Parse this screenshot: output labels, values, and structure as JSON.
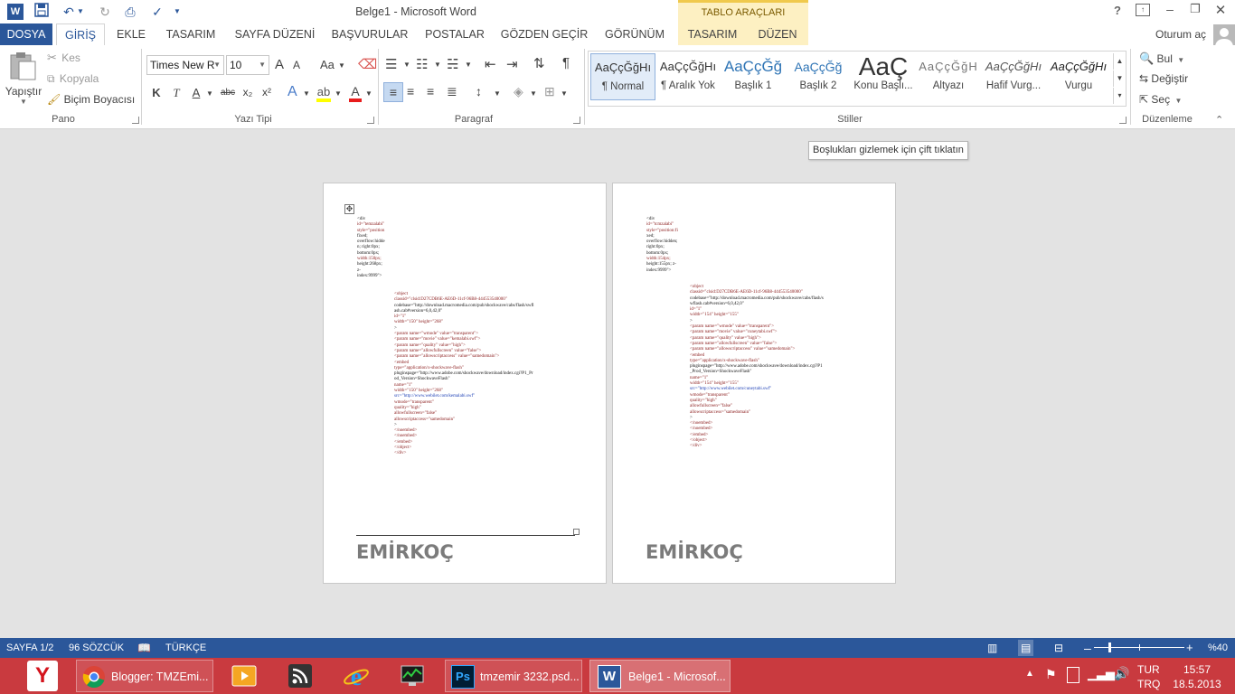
{
  "window": {
    "title": "Belge1 - Microsoft Word",
    "contextual_group": "TABLO ARAÇLARI",
    "help": "?",
    "user": "Oturum aç"
  },
  "tabs": [
    "DOSYA",
    "GİRİŞ",
    "EKLE",
    "TASARIM",
    "SAYFA DÜZENİ",
    "BAŞVURULAR",
    "POSTALAR",
    "GÖZDEN GEÇİR",
    "GÖRÜNÜM",
    "TASARIM",
    "DÜZEN"
  ],
  "clipboard": {
    "paste": "Yapıştır",
    "cut": "Kes",
    "copy": "Kopyala",
    "format_painter": "Biçim Boyacısı",
    "label": "Pano"
  },
  "font": {
    "name": "Times New R",
    "size": "10",
    "label": "Yazı Tipi",
    "bold": "K",
    "italic": "T",
    "underline": "A",
    "strike": "abc",
    "sub": "x₂",
    "sup": "x²",
    "grow": "A",
    "shrink": "A",
    "case": "Aa",
    "color_letter": "A"
  },
  "paragraph": {
    "label": "Paragraf"
  },
  "styles": {
    "label": "Stiller",
    "items": [
      {
        "preview": "AaÇçĞğHı",
        "name": "¶ Normal"
      },
      {
        "preview": "AaÇçĞğHı",
        "name": "¶ Aralık Yok"
      },
      {
        "preview": "AaÇçĞğ",
        "name": "Başlık 1"
      },
      {
        "preview": "AaÇçĞğ",
        "name": "Başlık 2"
      },
      {
        "preview": "AaÇ",
        "name": "Konu Başlı..."
      },
      {
        "preview": "AaÇçĞğH",
        "name": "Altyazı"
      },
      {
        "preview": "AaÇçĞğHı",
        "name": "Hafif Vurg..."
      },
      {
        "preview": "AaÇçĞğHı",
        "name": "Vurgu"
      }
    ]
  },
  "editing": {
    "find": "Bul",
    "replace": "Değiştir",
    "select": "Seç",
    "label": "Düzenleme"
  },
  "tooltip": "Boşlukları gizlemek için çift tıklatın",
  "pages": [
    {
      "code_lines": [
        "<div",
        "id=\"temzalabi\"",
        "style=\"position",
        "fixed;",
        "overflow:hidde",
        "n; right:0px;",
        "bottom:0px;",
        "width:150px;",
        "height:268px;",
        "z-",
        "index:9999\">"
      ],
      "code_lines2": [
        "<object",
        "classid=\"clsid:D27CDB6E-AE6D-11cf-96B8-444553540000\"",
        "codebase=\"http://download.macromedia.com/pub/shockwave/cabs/flash/swfl",
        "ash.cab#version=6,0,42,0\"",
        "id=\"1\"",
        "width=\"150\" height=\"268\"",
        ">",
        "<param name=\"wmode\" value=\"transparent\">",
        "<param name=\"movie\" value=\"kemalabi.swf\">",
        "<param name=\"quality\" value=\"high\">",
        "<param name=\"allowfullscreen\" value=\"false\">",
        "<param name=\"allowscriptaccess\" value=\"samedomain\">",
        "<embed",
        "type=\"application/x-shockwave-flash\"",
        "pluginspage=\"http://www.adobe.com/shockwave/download/index.cgi?P1_Pr",
        "od_Version=ShockwaveFlash\"",
        "name=\"1\"",
        "width=\"150\" height=\"268\"",
        "src=\"http://www.webilet.com/kemalabi.swf\"",
        "wmode=\"transparent\"",
        "quality=\"high\"",
        "allowfullscreen=\"false\"",
        "allowscriptaccess=\"samedomain\"",
        ">",
        "</noembed>",
        "</noembed>",
        "</embed>",
        "</object>",
        "",
        "</div>"
      ],
      "footer": "EMİRKOÇ"
    },
    {
      "code_lines": [
        "<div",
        "id=\"tcmzalabi\"",
        "style=\"position:fi",
        "xed;",
        "overflow:hidden;",
        "right:0px;",
        "bottom:0px;",
        "width:154px;",
        "height:155px; z-",
        "index:9999\">"
      ],
      "code_lines2": [
        "<object",
        "classid=\"clsid:D27CDB6E-AE6D-11cf-96B8-444553540000\"",
        "codebase=\"http://download.macromedia.com/pub/shockwave/cabs/flash/s",
        "wflash.cab#version=6,0,42,0\"",
        "id=\"1\"",
        "width=\"154\" height=\"155\"",
        ">",
        "<param name=\"wmode\" value=\"transparent\">",
        "<param name=\"movie\" value=\"cuneytabi.swf\">",
        "<param name=\"quality\" value=\"high\">",
        "<param name=\"allowfullscreen\" value=\"false\">",
        "<param name=\"allowscriptaccess\" value=\"samedomain\">",
        "<embed",
        "type=\"application/x-shockwave-flash\"",
        "pluginspage=\"http://www.adobe.com/shockwave/download/index.cgi?P1",
        "_Prod_Version=ShockwaveFlash\"",
        "name=\"1\"",
        "width=\"154\" height=\"155\"",
        "src=\"http://www.webilet.com/cuneytabi.swf\"",
        "wmode=\"transparent\"",
        "quality=\"high\"",
        "allowfullscreen=\"false\"",
        "allowscriptaccess=\"samedomain\"",
        ">",
        "</noembed>",
        "</noembed>",
        "</embed>",
        "</object>",
        "",
        "</div>"
      ],
      "footer": "EMİRKOÇ"
    }
  ],
  "status": {
    "page": "SAYFA 1/2",
    "words": "96 SÖZCÜK",
    "language": "TÜRKÇE",
    "zoom": "%40",
    "zoom_level": 0.4
  },
  "taskbar": {
    "apps": [
      "Blogger: TMZEmi...",
      "tmzemir 3232.psd...",
      "Belge1 - Microsof..."
    ],
    "lang1": "TUR",
    "lang2": "TRQ",
    "time": "15:57",
    "date": "18.5.2013"
  },
  "colors": {
    "accent": "#2b579a",
    "taskbar": "#c93a3f",
    "contextual": "#fdf0c2"
  }
}
